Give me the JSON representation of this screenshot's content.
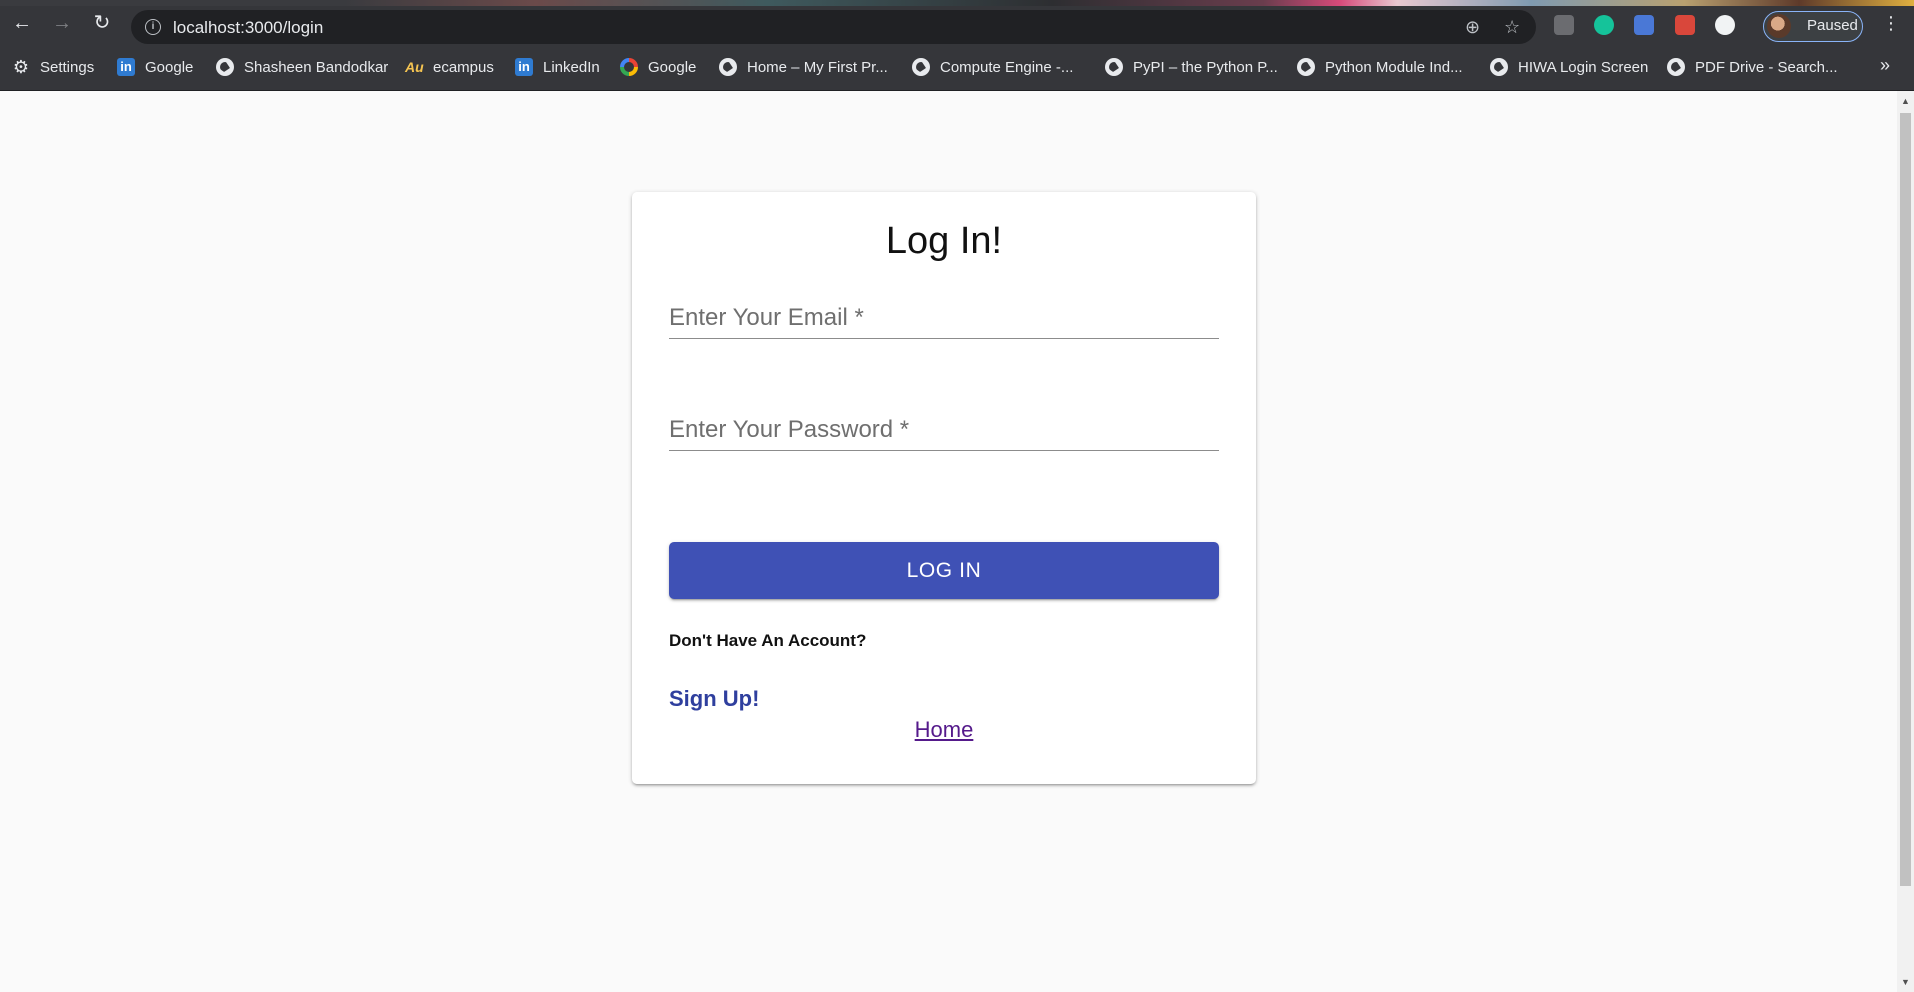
{
  "browser": {
    "url": "localhost:3000/login",
    "profile_label": "Paused",
    "bookmarks": [
      {
        "label": "Settings",
        "icon": "gear-icon"
      },
      {
        "label": "Google",
        "icon": "linkedin-icon"
      },
      {
        "label": "Shasheen Bandodkar",
        "icon": "globe-icon"
      },
      {
        "label": "ecampus",
        "icon": "au-icon"
      },
      {
        "label": "LinkedIn",
        "icon": "linkedin-icon"
      },
      {
        "label": "Google",
        "icon": "google-icon"
      },
      {
        "label": "Home – My First Pr...",
        "icon": "globe-icon"
      },
      {
        "label": "Compute Engine -...",
        "icon": "globe-icon"
      },
      {
        "label": "PyPI – the Python P...",
        "icon": "globe-icon"
      },
      {
        "label": "Python Module Ind...",
        "icon": "globe-icon"
      },
      {
        "label": "HIWA Login Screen",
        "icon": "globe-icon"
      },
      {
        "label": "PDF Drive - Search...",
        "icon": "globe-icon"
      }
    ],
    "more_bookmarks_glyph": "»"
  },
  "login": {
    "title": "Log In!",
    "email_placeholder": "Enter Your Email *",
    "password_placeholder": "Enter Your Password *",
    "login_button": "LOG IN",
    "no_account_text": "Don't Have An Account?",
    "signup_link": "Sign Up!",
    "home_link": "Home"
  },
  "colors": {
    "primary_button": "#3f51b5",
    "signup_link": "#2f3f9e",
    "visited_link": "#551a8b"
  }
}
